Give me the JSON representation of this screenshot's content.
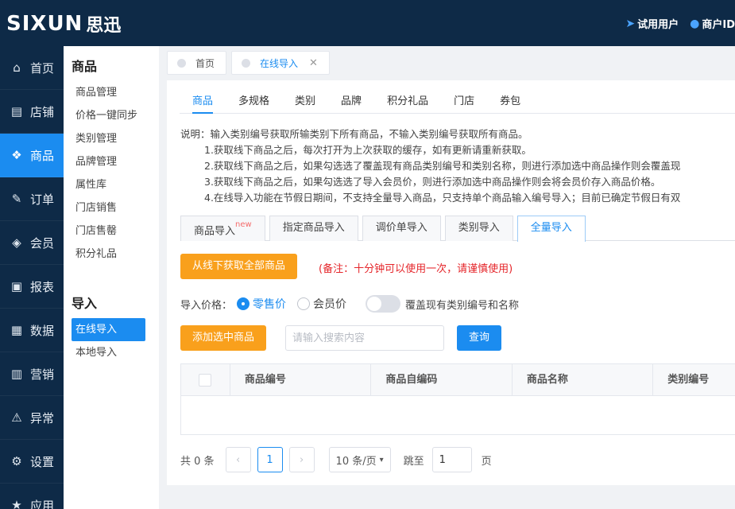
{
  "header": {
    "logo_text": "SIXUN",
    "logo_cn": "思迅",
    "trial_user": "试用用户",
    "merchant": "商户ID"
  },
  "sidenav": [
    {
      "label": "首页",
      "icon": "home-icon",
      "glyph": "⌂"
    },
    {
      "label": "店铺",
      "icon": "shop-icon",
      "glyph": "▤"
    },
    {
      "label": "商品",
      "icon": "gift-icon",
      "glyph": "❖"
    },
    {
      "label": "订单",
      "icon": "order-icon",
      "glyph": "✎"
    },
    {
      "label": "会员",
      "icon": "member-icon",
      "glyph": "◈"
    },
    {
      "label": "报表",
      "icon": "report-icon",
      "glyph": "▣"
    },
    {
      "label": "数据",
      "icon": "data-icon",
      "glyph": "▦"
    },
    {
      "label": "营销",
      "icon": "marketing-icon",
      "glyph": "▥"
    },
    {
      "label": "异常",
      "icon": "warning-icon",
      "glyph": "⚠"
    },
    {
      "label": "设置",
      "icon": "settings-icon",
      "glyph": "⚙"
    },
    {
      "label": "应用",
      "icon": "app-icon",
      "glyph": "★"
    }
  ],
  "submenu": {
    "title": "商品",
    "items": [
      "商品管理",
      "价格一键同步",
      "类别管理",
      "品牌管理",
      "属性库",
      "门店销售",
      "门店售罄",
      "积分礼品"
    ],
    "title2": "导入",
    "items2": [
      "在线导入",
      "本地导入"
    ]
  },
  "pagetabs": [
    "首页",
    "在线导入"
  ],
  "category_tabs": [
    "商品",
    "多规格",
    "类别",
    "品牌",
    "积分礼品",
    "门店",
    "券包"
  ],
  "notes": [
    "说明：输入类别编号获取所输类别下所有商品，不输入类别编号获取所有商品。",
    "1.获取线下商品之后，每次打开为上次获取的缓存，如有更新请重新获取。",
    "2.获取线下商品之后，如果勾选选了覆盖现有商品类别编号和类别名称，则进行添加选中商品操作则会覆盖现",
    "3.获取线下商品之后，如果勾选选了导入会员价，则进行添加选中商品操作则会将会员价存入商品价格。",
    "4.在线导入功能在节假日期间，不支持全量导入商品，只支持单个商品输入编号导入；目前已确定节假日有双"
  ],
  "import_tabs": {
    "items": [
      "商品导入",
      "指定商品导入",
      "调价单导入",
      "类别导入",
      "全量导入"
    ],
    "new_badge": "new"
  },
  "actions": {
    "fetch_all": "从线下获取全部商品",
    "remark": "(备注：十分钟可以使用一次，请谨慎使用)",
    "price_label": "导入价格：",
    "retail": "零售价",
    "member": "会员价",
    "overwrite": "覆盖现有类别编号和名称",
    "add_selected": "添加选中商品",
    "search_placeholder": "请输入搜索内容",
    "query": "查询"
  },
  "table": {
    "columns": [
      "商品编号",
      "商品自编码",
      "商品名称",
      "类别编号"
    ]
  },
  "pager": {
    "total": "共 0 条",
    "current_page": "1",
    "page_size": "10 条/页",
    "jump_label": "跳至",
    "jump_value": "1",
    "page_suffix": "页"
  }
}
